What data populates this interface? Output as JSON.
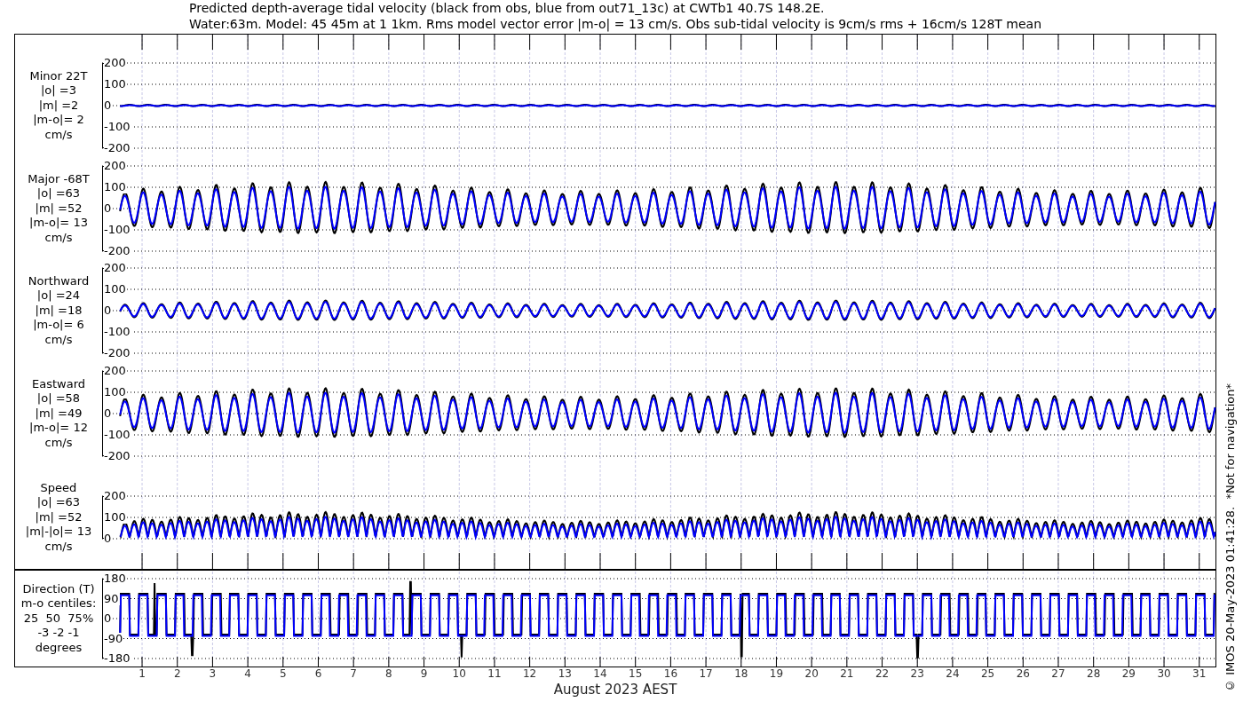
{
  "title_lines": [
    "Predicted depth-average tidal velocity (black from obs, blue from out71_13c) at CWTb1 40.7S 148.2E.",
    "Water:63m. Model: 45 45m at 1 1km. Rms model vector error |m-o| = 13 cm/s. Obs sub-tidal velocity is 9cm/s rms + 16cm/s 128T mean"
  ],
  "panels": [
    {
      "kind": "minor",
      "label_lines": [
        "Minor 22T",
        "|o| =3",
        "|m| =2",
        "|m-o|= 2",
        "cm/s"
      ],
      "yticks": [
        "200",
        "100",
        "0",
        "-100",
        "-200"
      ]
    },
    {
      "kind": "major",
      "label_lines": [
        "Major -68T",
        "|o| =63",
        "|m| =52",
        "|m-o|= 13",
        "cm/s"
      ],
      "yticks": [
        "200",
        "100",
        "0",
        "-100",
        "-200"
      ]
    },
    {
      "kind": "northward",
      "label_lines": [
        "Northward",
        "|o| =24",
        "|m| =18",
        "|m-o|= 6",
        "cm/s"
      ],
      "yticks": [
        "200",
        "100",
        "0",
        "-100",
        "-200"
      ]
    },
    {
      "kind": "eastward",
      "label_lines": [
        "Eastward",
        "|o| =58",
        "|m| =49",
        "|m-o|= 12",
        "cm/s"
      ],
      "yticks": [
        "200",
        "100",
        "0",
        "-100",
        "-200"
      ]
    },
    {
      "kind": "speed",
      "label_lines": [
        "Speed",
        "|o| =63",
        "|m| =52",
        "|m|-|o|= 13",
        "cm/s"
      ],
      "yticks": [
        "200",
        "100",
        "0"
      ]
    }
  ],
  "direction_panel": {
    "kind": "direction",
    "label_lines": [
      "Direction (T)",
      "m-o centiles:",
      "25  50  75%",
      "-3 -2 -1",
      "degrees"
    ],
    "yticks": [
      "180",
      "90",
      "0",
      "-90",
      "-180"
    ]
  },
  "x_axis": {
    "ticks": [
      "1",
      "2",
      "3",
      "4",
      "5",
      "6",
      "7",
      "8",
      "9",
      "10",
      "11",
      "12",
      "13",
      "14",
      "15",
      "16",
      "17",
      "18",
      "19",
      "20",
      "21",
      "22",
      "23",
      "24",
      "25",
      "26",
      "27",
      "28",
      "29",
      "30",
      "31"
    ],
    "label": "August 2023 AEST"
  },
  "credit": "© IMOS 20-May-2023 01:41:28.  *Not for navigation*"
}
